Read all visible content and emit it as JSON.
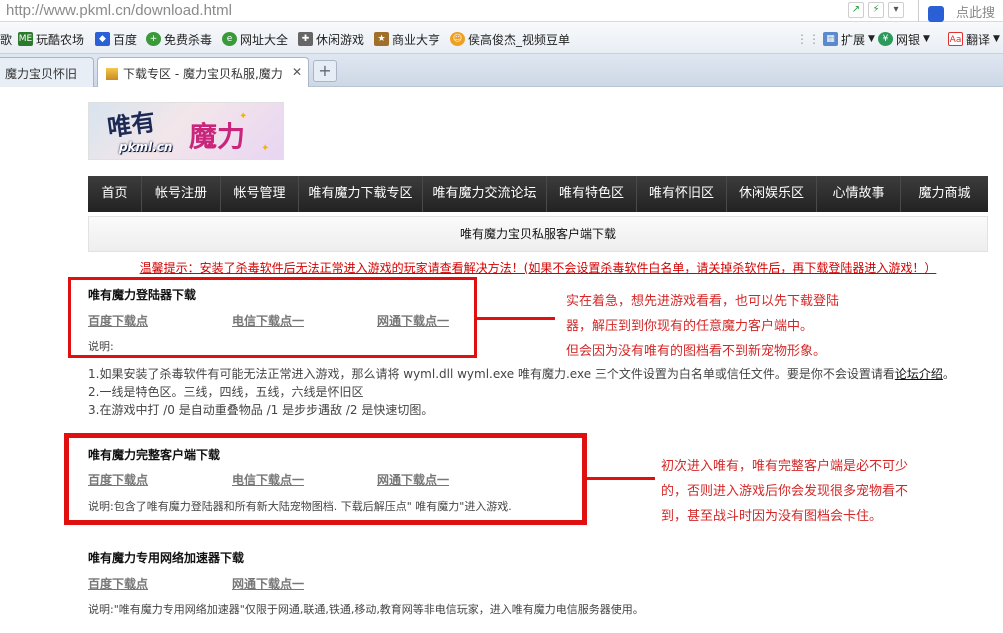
{
  "browser": {
    "url": "http://www.pkml.cn/download.html",
    "search_placeholder": "点此搜",
    "bookmarks": [
      {
        "label": "歌",
        "icon": "none"
      },
      {
        "label": "玩酷农场",
        "icon": "farm-icon"
      },
      {
        "label": "百度",
        "icon": "baidu-icon"
      },
      {
        "label": "免费杀毒",
        "icon": "antivirus-icon"
      },
      {
        "label": "网址大全",
        "icon": "globe-icon"
      },
      {
        "label": "休闲游戏",
        "icon": "gamepad-icon"
      },
      {
        "label": "商业大亨",
        "icon": "business-icon"
      },
      {
        "label": "侯高俊杰_视频豆单",
        "icon": "video-icon"
      }
    ],
    "extensions": [
      {
        "label": "扩展",
        "icon": "grid-icon"
      },
      {
        "label": "网银",
        "icon": "bank-icon"
      },
      {
        "label": "翻译",
        "icon": "translate-icon"
      }
    ],
    "tabs": [
      {
        "label": "魔力宝贝怀旧",
        "active": false
      },
      {
        "label": "下载专区 - 魔力宝贝私服,魔力",
        "active": true
      }
    ],
    "new_tab": "+"
  },
  "logo": {
    "title": "唯有",
    "brand": "魔力",
    "domain": "pkml.cn"
  },
  "nav": [
    "首页",
    "帐号注册",
    "帐号管理",
    "唯有魔力下载专区",
    "唯有魔力交流论坛",
    "唯有特色区",
    "唯有怀旧区",
    "休闲娱乐区",
    "心情故事",
    "魔力商城"
  ],
  "header_bar": "唯有魔力宝贝私服客户端下载",
  "notice": "温馨提示：安装了杀毒软件后无法正常进入游戏的玩家请查看解决方法！(如果不会设置杀毒软件白名单，请关掉杀软件后，再下载登陆器进入游戏！）",
  "sections": [
    {
      "title": "唯有魔力登陆器下载",
      "links": [
        "百度下载点",
        "电信下载点一",
        "网通下载点一"
      ],
      "desc": "说明:"
    },
    {
      "title": "唯有魔力完整客户端下载",
      "links": [
        "百度下载点",
        "电信下载点一",
        "网通下载点一"
      ],
      "desc": "说明:包含了唯有魔力登陆器和所有新大陆宠物图档. 下载后解压点\" 唯有魔力\"进入游戏."
    },
    {
      "title": "唯有魔力专用网络加速器下载",
      "links": [
        "百度下载点",
        "网通下载点一"
      ],
      "desc": "说明:\"唯有魔力专用网络加速器\"仅限于网通,联通,铁通,移动,教育网等非电信玩家，进入唯有魔力电信服务器使用。"
    }
  ],
  "notes": {
    "line1_pre": "1.如果安装了杀毒软件有可能无法正常进入游戏，那么请将 wyml.dll wyml.exe 唯有魔力.exe 三个文件设置为白名单或信任文件。要是你不会设置请看",
    "line1_link": "论坛介绍",
    "line1_post": "。",
    "line2": "2.一线是特色区。三线，四线，五线，六线是怀旧区",
    "line3": "3.在游戏中打 /0 是自动重叠物品 /1 是步步遇敌 /2 是快速切图。"
  },
  "callouts": {
    "first": [
      "实在着急，想先进游戏看看，也可以先下载登陆",
      "器，解压到到你现有的任意魔力客户端中。",
      "但会因为没有唯有的图档看不到新宠物形象。"
    ],
    "second": [
      "初次进入唯有，唯有完整客户端是必不可少",
      "的，否则进入游戏后你会发现很多宠物看不",
      "到，甚至战斗时因为没有图档会卡住。"
    ]
  },
  "colors": {
    "annotation_red": "#e01010",
    "nav_bg": "#2a2a2a",
    "notice_red": "#d40000"
  }
}
